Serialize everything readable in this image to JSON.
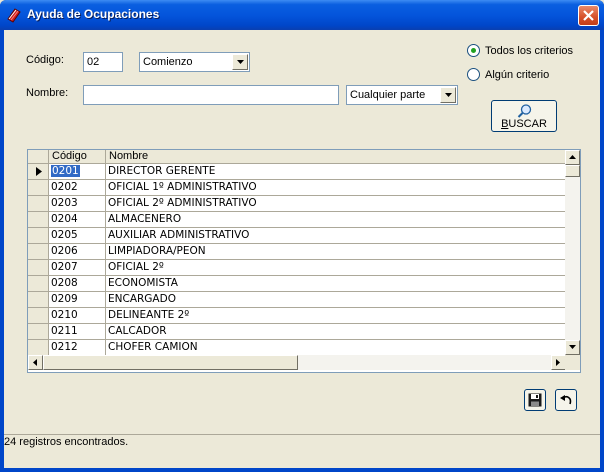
{
  "window": {
    "title": "Ayuda de Ocupaciones"
  },
  "form": {
    "codigo_label": "Código:",
    "codigo_value": "02",
    "codigo_mode": "Comienzo",
    "nombre_label": "Nombre:",
    "nombre_value": "",
    "nombre_mode": "Cualquier parte",
    "radio_todos": "Todos los criterios",
    "radio_algun": "Algún criterio",
    "radio_selected": "todos",
    "buscar_prefix": "B",
    "buscar_rest": "USCAR"
  },
  "grid": {
    "columns": [
      "Código",
      "Nombre"
    ],
    "rows": [
      [
        "0201",
        "DIRECTOR GERENTE"
      ],
      [
        "0202",
        "OFICIAL 1º ADMINISTRATIVO"
      ],
      [
        "0203",
        "OFICIAL 2º ADMINISTRATIVO"
      ],
      [
        "0204",
        "ALMACENERO"
      ],
      [
        "0205",
        "AUXILIAR ADMINISTRATIVO"
      ],
      [
        "0206",
        "LIMPIADORA/PEON"
      ],
      [
        "0207",
        "OFICIAL 2º"
      ],
      [
        "0208",
        "ECONOMISTA"
      ],
      [
        "0209",
        "ENCARGADO"
      ],
      [
        "0210",
        "DELINEANTE 2º"
      ],
      [
        "0211",
        "CALCADOR"
      ],
      [
        "0212",
        "CHOFER CAMION"
      ]
    ],
    "active_row": 0
  },
  "status": {
    "text": "24 registros encontrados."
  },
  "colors": {
    "titlebar": "#0455dc",
    "selection": "#316ac5",
    "radio_dot": "#21a121"
  }
}
